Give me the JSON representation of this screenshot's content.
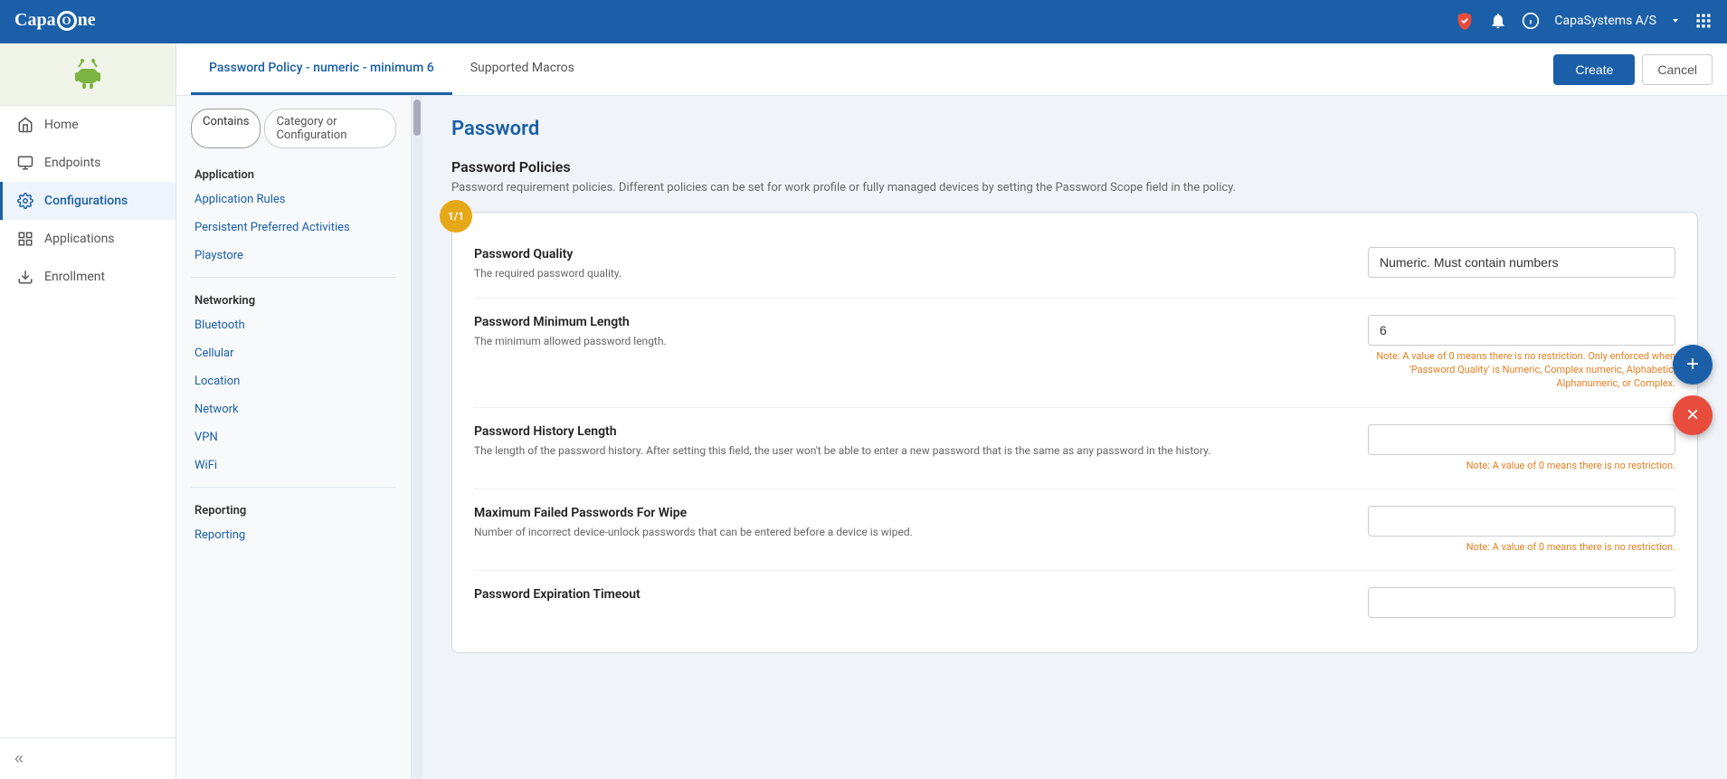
{
  "topNav": {
    "logoText": "Capa",
    "logoO": "O",
    "logoEnd": "ne",
    "companyName": "CapaSystems A/S",
    "icons": {
      "shield": "🛡",
      "bell": "🔔",
      "info": "ℹ"
    }
  },
  "configHeader": {
    "profileName": "Password Policy - numeric - minimum 6",
    "tabs": [
      {
        "id": "profile",
        "label": "Password Policy - numeric - minimum 6",
        "active": true
      },
      {
        "id": "macros",
        "label": "Supported Macros",
        "active": false
      }
    ],
    "createLabel": "Create",
    "cancelLabel": "Cancel"
  },
  "filterTabs": [
    {
      "id": "contains",
      "label": "Contains",
      "active": true
    },
    {
      "id": "category",
      "label": "Category or Configuration",
      "active": false
    }
  ],
  "leftNav": {
    "sections": [
      {
        "header": "Application",
        "items": [
          {
            "id": "app-rules",
            "label": "Application Rules",
            "active": false
          },
          {
            "id": "persistent",
            "label": "Persistent Preferred Activities",
            "active": false
          },
          {
            "id": "playstore",
            "label": "Playstore",
            "active": false
          }
        ]
      },
      {
        "header": "Networking",
        "items": [
          {
            "id": "bluetooth",
            "label": "Bluetooth",
            "active": false
          },
          {
            "id": "cellular",
            "label": "Cellular",
            "active": false
          },
          {
            "id": "location",
            "label": "Location",
            "active": false
          },
          {
            "id": "network",
            "label": "Network",
            "active": false
          },
          {
            "id": "vpn",
            "label": "VPN",
            "active": false
          },
          {
            "id": "wifi",
            "label": "WiFi",
            "active": false
          }
        ]
      },
      {
        "header": "Reporting",
        "items": [
          {
            "id": "reporting",
            "label": "Reporting",
            "active": false
          }
        ]
      }
    ]
  },
  "mainContent": {
    "sectionTitle": "Password",
    "subsectionTitle": "Password Policies",
    "subsectionDesc": "Password requirement policies. Different policies can be set for work profile or fully managed devices by setting the Password Scope field in the policy.",
    "policyBadge": "1/1",
    "formFields": [
      {
        "id": "password-quality",
        "label": "Password Quality",
        "desc": "The required password quality.",
        "value": "Numeric. Must contain numbers",
        "inputType": "text",
        "note": ""
      },
      {
        "id": "password-min-length",
        "label": "Password Minimum Length",
        "desc": "The minimum allowed password length.",
        "value": "6",
        "inputType": "text",
        "note": "Note: A value of 0 means there is no restriction. Only enforced when 'Password Quality' is Numeric, Complex numeric, Alphabetic, Alphanumeric, or Complex."
      },
      {
        "id": "password-history",
        "label": "Password History Length",
        "desc": "The length of the password history. After setting this field, the user won't be able to enter a new password that is the same as any password in the history.",
        "value": "",
        "inputType": "text",
        "note": "Note: A value of 0 means there is no restriction."
      },
      {
        "id": "max-failed",
        "label": "Maximum Failed Passwords For Wipe",
        "desc": "Number of incorrect device-unlock passwords that can be entered before a device is wiped.",
        "value": "",
        "inputType": "text",
        "note": "Note: A value of 0 means there is no restriction."
      },
      {
        "id": "password-expiry",
        "label": "Password Expiration Timeout",
        "desc": "",
        "value": "",
        "inputType": "text",
        "note": ""
      }
    ]
  },
  "sidebar": {
    "navItems": [
      {
        "id": "home",
        "label": "Home",
        "active": false
      },
      {
        "id": "endpoints",
        "label": "Endpoints",
        "active": false
      },
      {
        "id": "configurations",
        "label": "Configurations",
        "active": true
      },
      {
        "id": "applications",
        "label": "Applications",
        "active": false
      },
      {
        "id": "enrollment",
        "label": "Enrollment",
        "active": false
      }
    ],
    "collapseLabel": "«"
  }
}
